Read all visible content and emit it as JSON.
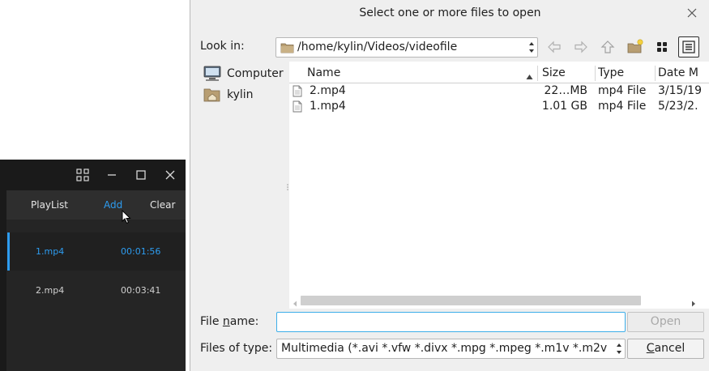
{
  "player": {
    "tabs": [
      {
        "label": "PlayList"
      },
      {
        "label": "Add"
      },
      {
        "label": "Clear"
      }
    ],
    "items": [
      {
        "name": "1.mp4",
        "duration": "00:01:56"
      },
      {
        "name": "2.mp4",
        "duration": "00:03:41"
      }
    ],
    "accent_color": "#2d9cf0",
    "window_icons": [
      "grid-icon",
      "minimize-icon",
      "maximize-icon",
      "close-icon"
    ]
  },
  "dialog": {
    "title": "Select one or more files to open",
    "look_in_label": "Look in:",
    "look_in_path": "/home/kylin/Videos/videofile",
    "sidebar": [
      {
        "label": "Computer",
        "icon": "computer-icon"
      },
      {
        "label": "kylin",
        "icon": "home-folder-icon"
      }
    ],
    "columns": {
      "name": "Name",
      "size": "Size",
      "type": "Type",
      "date": "Date M"
    },
    "files": [
      {
        "name": "2.mp4",
        "size": "22…MB",
        "type": "mp4 File",
        "date": "3/15/19"
      },
      {
        "name": "1.mp4",
        "size": "1.01 GB",
        "type": "mp4 File",
        "date": "5/23/2."
      }
    ],
    "file_name_label_pre": "File ",
    "file_name_label_mnemonic": "n",
    "file_name_label_post": "ame:",
    "file_name_value": "",
    "open_label": "Open",
    "files_of_type_label": "Files of type:",
    "files_of_type_value": "Multimedia (*.avi *.vfw *.divx *.mpg *.mpeg *.m1v *.m2v *.m",
    "cancel_mnemonic": "C",
    "cancel_rest": "ancel",
    "focus_color": "#3daee9"
  }
}
